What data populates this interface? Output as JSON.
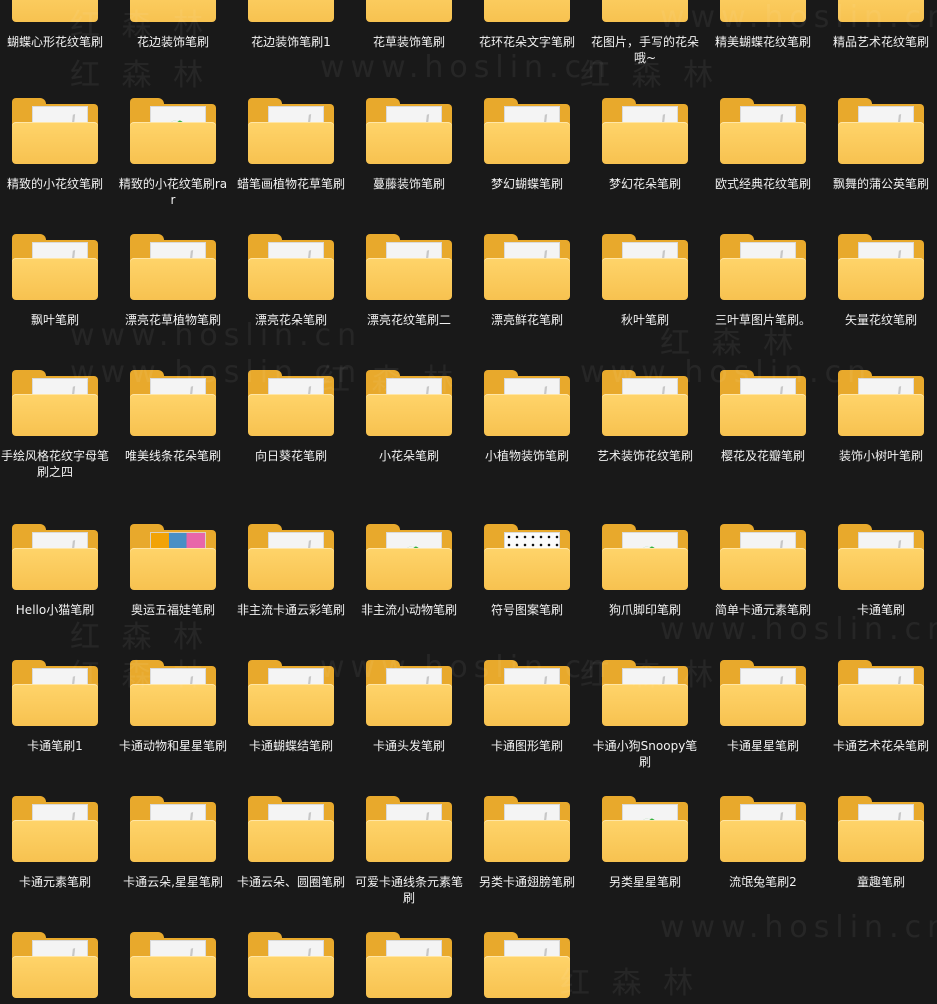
{
  "rows": [
    {
      "items": [
        {
          "name": "蝴蝶心形花纹笔刷",
          "icon": "folder-icon"
        },
        {
          "name": "花边装饰笔刷",
          "icon": "folder-icon"
        },
        {
          "name": "花边装饰笔刷1",
          "icon": "folder-icon"
        },
        {
          "name": "花草装饰笔刷",
          "icon": "folder-icon"
        },
        {
          "name": "花环花朵文字笔刷",
          "icon": "folder-icon"
        },
        {
          "name": "花图片，手写的花朵哦~",
          "icon": "folder-icon"
        },
        {
          "name": "精美蝴蝶花纹笔刷",
          "icon": "folder-icon"
        },
        {
          "name": "精品艺术花纹笔刷",
          "icon": "folder-icon"
        }
      ]
    },
    {
      "items": [
        {
          "name": "精致的小花纹笔刷",
          "icon": "folder-icon"
        },
        {
          "name": "精致的小花纹笔刷rar",
          "icon": "folder-green-icon"
        },
        {
          "name": "蜡笔画植物花草笔刷",
          "icon": "folder-icon"
        },
        {
          "name": "蔓藤装饰笔刷",
          "icon": "folder-icon"
        },
        {
          "name": "梦幻蝴蝶笔刷",
          "icon": "folder-icon"
        },
        {
          "name": "梦幻花朵笔刷",
          "icon": "folder-icon"
        },
        {
          "name": "欧式经典花纹笔刷",
          "icon": "folder-icon"
        },
        {
          "name": "飘舞的蒲公英笔刷",
          "icon": "folder-icon"
        }
      ]
    },
    {
      "items": [
        {
          "name": "飘叶笔刷",
          "icon": "folder-icon"
        },
        {
          "name": "漂亮花草植物笔刷",
          "icon": "folder-icon"
        },
        {
          "name": "漂亮花朵笔刷",
          "icon": "folder-icon"
        },
        {
          "name": "漂亮花纹笔刷二",
          "icon": "folder-icon"
        },
        {
          "name": "漂亮鲜花笔刷",
          "icon": "folder-icon"
        },
        {
          "name": "秋叶笔刷",
          "icon": "folder-icon"
        },
        {
          "name": "三叶草图片笔刷。",
          "icon": "folder-icon"
        },
        {
          "name": "矢量花纹笔刷",
          "icon": "folder-icon"
        }
      ]
    },
    {
      "items": [
        {
          "name": "手绘风格花纹字母笔刷之四",
          "icon": "folder-icon"
        },
        {
          "name": "唯美线条花朵笔刷",
          "icon": "folder-icon"
        },
        {
          "name": "向日葵花笔刷",
          "icon": "folder-icon"
        },
        {
          "name": "小花朵笔刷",
          "icon": "folder-icon"
        },
        {
          "name": "小植物装饰笔刷",
          "icon": "folder-icon"
        },
        {
          "name": "艺术装饰花纹笔刷",
          "icon": "folder-icon"
        },
        {
          "name": "樱花及花瓣笔刷",
          "icon": "folder-icon"
        },
        {
          "name": "装饰小树叶笔刷",
          "icon": "folder-icon"
        }
      ]
    },
    {
      "items": [
        {
          "name": "Hello小猫笔刷",
          "icon": "folder-icon"
        },
        {
          "name": "奥运五福娃笔刷",
          "icon": "folder-mascots-icon"
        },
        {
          "name": "非主流卡通云彩笔刷",
          "icon": "folder-icon"
        },
        {
          "name": "非主流小动物笔刷",
          "icon": "folder-green-icon"
        },
        {
          "name": "符号图案笔刷",
          "icon": "folder-symbols-icon"
        },
        {
          "name": "狗爪脚印笔刷",
          "icon": "folder-green-icon"
        },
        {
          "name": "简单卡通元素笔刷",
          "icon": "folder-icon"
        },
        {
          "name": "卡通笔刷",
          "icon": "folder-icon"
        }
      ]
    },
    {
      "items": [
        {
          "name": "卡通笔刷1",
          "icon": "folder-icon"
        },
        {
          "name": "卡通动物和星星笔刷",
          "icon": "folder-icon"
        },
        {
          "name": "卡通蝴蝶结笔刷",
          "icon": "folder-icon"
        },
        {
          "name": "卡通头发笔刷",
          "icon": "folder-icon"
        },
        {
          "name": "卡通图形笔刷",
          "icon": "folder-icon"
        },
        {
          "name": "卡通小狗Snoopy笔刷",
          "icon": "folder-icon"
        },
        {
          "name": "卡通星星笔刷",
          "icon": "folder-icon"
        },
        {
          "name": "卡通艺术花朵笔刷",
          "icon": "folder-icon"
        }
      ]
    },
    {
      "items": [
        {
          "name": "卡通元素笔刷",
          "icon": "folder-icon"
        },
        {
          "name": "卡通云朵,星星笔刷",
          "icon": "folder-icon"
        },
        {
          "name": "卡通云朵、圆圈笔刷",
          "icon": "folder-icon"
        },
        {
          "name": "可爱卡通线条元素笔刷",
          "icon": "folder-icon"
        },
        {
          "name": "另类卡通翅膀笔刷",
          "icon": "folder-icon"
        },
        {
          "name": "另类星星笔刷",
          "icon": "folder-green-icon"
        },
        {
          "name": "流氓兔笔刷2",
          "icon": "folder-icon"
        },
        {
          "name": "童趣笔刷",
          "icon": "folder-icon"
        }
      ]
    },
    {
      "items": [
        {
          "name": "",
          "icon": "folder-icon"
        },
        {
          "name": "",
          "icon": "folder-icon"
        },
        {
          "name": "",
          "icon": "folder-icon"
        },
        {
          "name": "",
          "icon": "folder-icon"
        },
        {
          "name": "",
          "icon": "folder-icon"
        }
      ]
    }
  ],
  "watermarks": [
    "红 森 林",
    "www.hoslin.cn"
  ],
  "colors": {
    "background": "#191919",
    "folder": "#f7c250",
    "folder_back": "#e8a92c",
    "label": "#f2f2f2"
  }
}
